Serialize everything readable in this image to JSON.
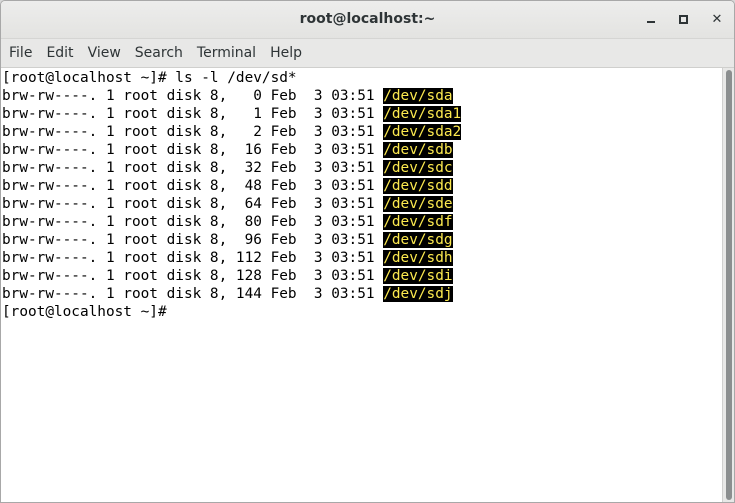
{
  "window": {
    "title": "root@localhost:~",
    "close_glyph": "✕"
  },
  "menu": [
    "File",
    "Edit",
    "View",
    "Search",
    "Terminal",
    "Help"
  ],
  "terminal": {
    "command_line": "[root@localhost ~]# ls -l /dev/sd*",
    "rows": [
      {
        "info": "brw-rw----. 1 root disk 8,   0 Feb  3 03:51 ",
        "device": "/dev/sda"
      },
      {
        "info": "brw-rw----. 1 root disk 8,   1 Feb  3 03:51 ",
        "device": "/dev/sda1"
      },
      {
        "info": "brw-rw----. 1 root disk 8,   2 Feb  3 03:51 ",
        "device": "/dev/sda2"
      },
      {
        "info": "brw-rw----. 1 root disk 8,  16 Feb  3 03:51 ",
        "device": "/dev/sdb"
      },
      {
        "info": "brw-rw----. 1 root disk 8,  32 Feb  3 03:51 ",
        "device": "/dev/sdc"
      },
      {
        "info": "brw-rw----. 1 root disk 8,  48 Feb  3 03:51 ",
        "device": "/dev/sdd"
      },
      {
        "info": "brw-rw----. 1 root disk 8,  64 Feb  3 03:51 ",
        "device": "/dev/sde"
      },
      {
        "info": "brw-rw----. 1 root disk 8,  80 Feb  3 03:51 ",
        "device": "/dev/sdf"
      },
      {
        "info": "brw-rw----. 1 root disk 8,  96 Feb  3 03:51 ",
        "device": "/dev/sdg"
      },
      {
        "info": "brw-rw----. 1 root disk 8, 112 Feb  3 03:51 ",
        "device": "/dev/sdh"
      },
      {
        "info": "brw-rw----. 1 root disk 8, 128 Feb  3 03:51 ",
        "device": "/dev/sdi"
      },
      {
        "info": "brw-rw----. 1 root disk 8, 144 Feb  3 03:51 ",
        "device": "/dev/sdj"
      }
    ],
    "prompt": "[root@localhost ~]#",
    "colors": {
      "device_fg": "#fce94f",
      "device_bg": "#000000"
    }
  }
}
